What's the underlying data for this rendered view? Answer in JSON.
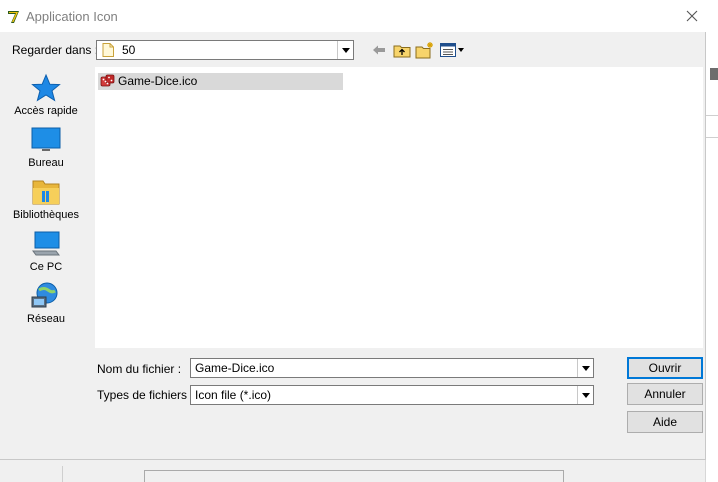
{
  "window": {
    "title": "Application Icon"
  },
  "lookin": {
    "label": "Regarder dans :",
    "value": "50"
  },
  "places": [
    {
      "label": "Accès rapide",
      "icon": "star-icon"
    },
    {
      "label": "Bureau",
      "icon": "desktop-icon"
    },
    {
      "label": "Bibliothèques",
      "icon": "libraries-icon"
    },
    {
      "label": "Ce PC",
      "icon": "computer-icon"
    },
    {
      "label": "Réseau",
      "icon": "network-icon"
    }
  ],
  "files": [
    {
      "name": "Game-Dice.ico",
      "icon": "dice-icon",
      "selected": true
    }
  ],
  "filename": {
    "label": "Nom du fichier :",
    "value": "Game-Dice.ico"
  },
  "filetype": {
    "label": "Types de fichiers :",
    "value": "Icon file (*.ico)"
  },
  "buttons": {
    "open": "Ouvrir",
    "cancel": "Annuler",
    "help": "Aide"
  },
  "colors": {
    "accent": "#0078d7",
    "selection": "#d9d9d9",
    "folder": "#e8b63b"
  }
}
